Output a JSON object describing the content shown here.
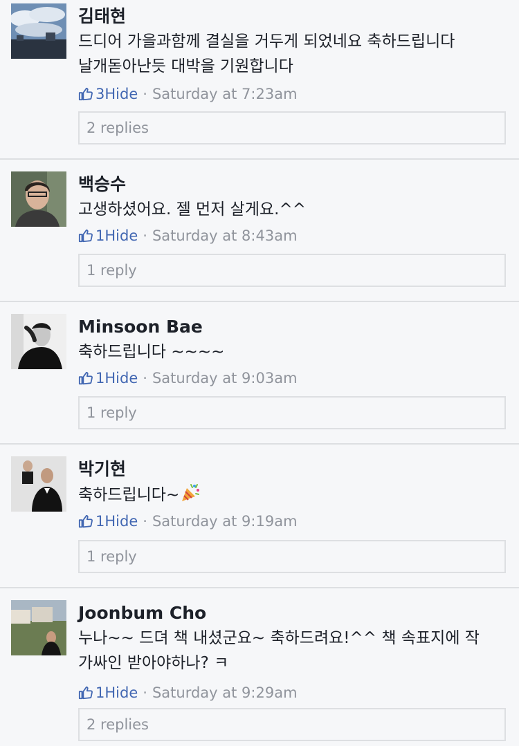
{
  "comments": [
    {
      "author": "김태현",
      "lines": [
        "드디어 가을과함께 결실을 거두게 되었네요 축하드립니다",
        "날개돋아난듯 대박을 기원합니다"
      ],
      "likes": "3",
      "hide": "Hide",
      "time": "Saturday at 7:23am",
      "replies": "2 replies"
    },
    {
      "author": "백승수",
      "lines": [
        "고생하셨어요. 젤 먼저 살게요.^^"
      ],
      "likes": "1",
      "hide": "Hide",
      "time": "Saturday at 8:43am",
      "replies": "1 reply"
    },
    {
      "author": "Minsoon Bae",
      "lines": [
        "축하드립니다 ~~~~"
      ],
      "likes": "1",
      "hide": "Hide",
      "time": "Saturday at 9:03am",
      "replies": "1 reply"
    },
    {
      "author": "박기현",
      "lines": [
        "축하드립니다~"
      ],
      "likes": "1",
      "hide": "Hide",
      "time": "Saturday at 9:19am",
      "replies": "1 reply"
    },
    {
      "author": "Joonbum Cho",
      "lines": [
        "누나~~ 드뎌 책 내셨군요~ 축하드려요!^^ 책 속표지에 작",
        "가싸인 받아야하나? ㅋ"
      ],
      "likes": "1",
      "hide": "Hide",
      "time": "Saturday at 9:29am",
      "replies": "2 replies"
    }
  ],
  "meta_separator": "·",
  "colors": {
    "link": "#4267b2",
    "muted": "#90949c",
    "background": "#f6f7f9",
    "border": "#dddfe2"
  },
  "icons": {
    "like": "thumbs-up-icon",
    "emoji": "party-popper-icon"
  }
}
